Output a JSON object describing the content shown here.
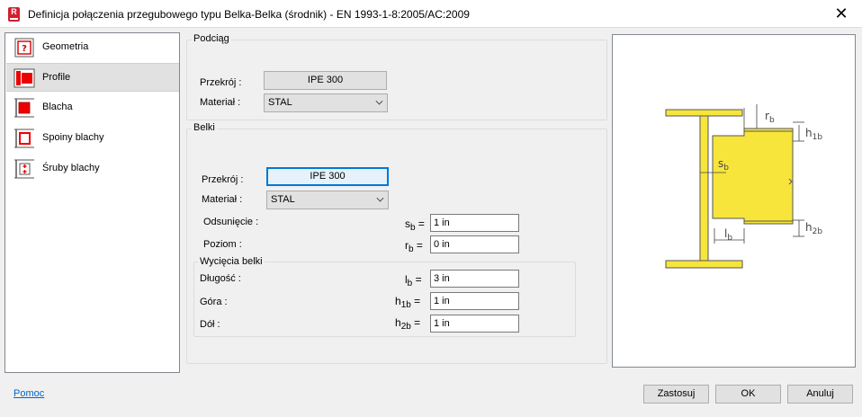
{
  "window": {
    "title": "Definicja połączenia przegubowego typu Belka-Belka (środnik) - EN 1993-1-8:2005/AC:2009",
    "close_glyph": "✕",
    "app_icon_letter": "R"
  },
  "nav": {
    "items": [
      {
        "label": "Geometria",
        "icon": "geometry-icon",
        "selected": false
      },
      {
        "label": "Profile",
        "icon": "profile-icon",
        "selected": true
      },
      {
        "label": "Blacha",
        "icon": "plate-icon",
        "selected": false
      },
      {
        "label": "Spoiny blachy",
        "icon": "weld-icon",
        "selected": false
      },
      {
        "label": "Śruby blachy",
        "icon": "bolt-icon",
        "selected": false
      }
    ]
  },
  "podciag": {
    "title": "Podciąg",
    "przekroj_label": "Przekrój :",
    "przekroj_value": "IPE 300",
    "material_label": "Materiał :",
    "material_value": "STAL"
  },
  "belki": {
    "title": "Belki",
    "przekroj_label": "Przekrój :",
    "przekroj_value": "IPE 300",
    "material_label": "Materiał :",
    "material_value": "STAL",
    "odsuniecie_label": "Odsunięcie :",
    "sb_sym": "s",
    "sb_sub": "b",
    "sb_value": "1 in",
    "poziom_label": "Poziom :",
    "rb_sym": "r",
    "rb_sub": "b",
    "rb_value": "0 in",
    "wyciecia": {
      "title": "Wycięcia belki",
      "dlugosc_label": "Długość :",
      "lb_sym": "l",
      "lb_sub": "b",
      "lb_value": "3 in",
      "gora_label": "Góra :",
      "h1b_sym": "h",
      "h1b_sub": "1b",
      "h1b_value": "1 in",
      "dol_label": "Dół :",
      "h2b_sym": "h",
      "h2b_sub": "2b",
      "h2b_value": "1 in"
    },
    "equals": "="
  },
  "preview": {
    "rb": "r",
    "rb_sub": "b",
    "h1b": "h",
    "h1b_sub": "1b",
    "h2b": "h",
    "h2b_sub": "2b",
    "sb": "s",
    "sb_sub": "b",
    "lb": "l",
    "lb_sub": "b",
    "steel_color": "#f7e53b"
  },
  "footer": {
    "help_link": "Pomoc",
    "apply": "Zastosuj",
    "ok": "OK",
    "cancel": "Anuluj"
  }
}
